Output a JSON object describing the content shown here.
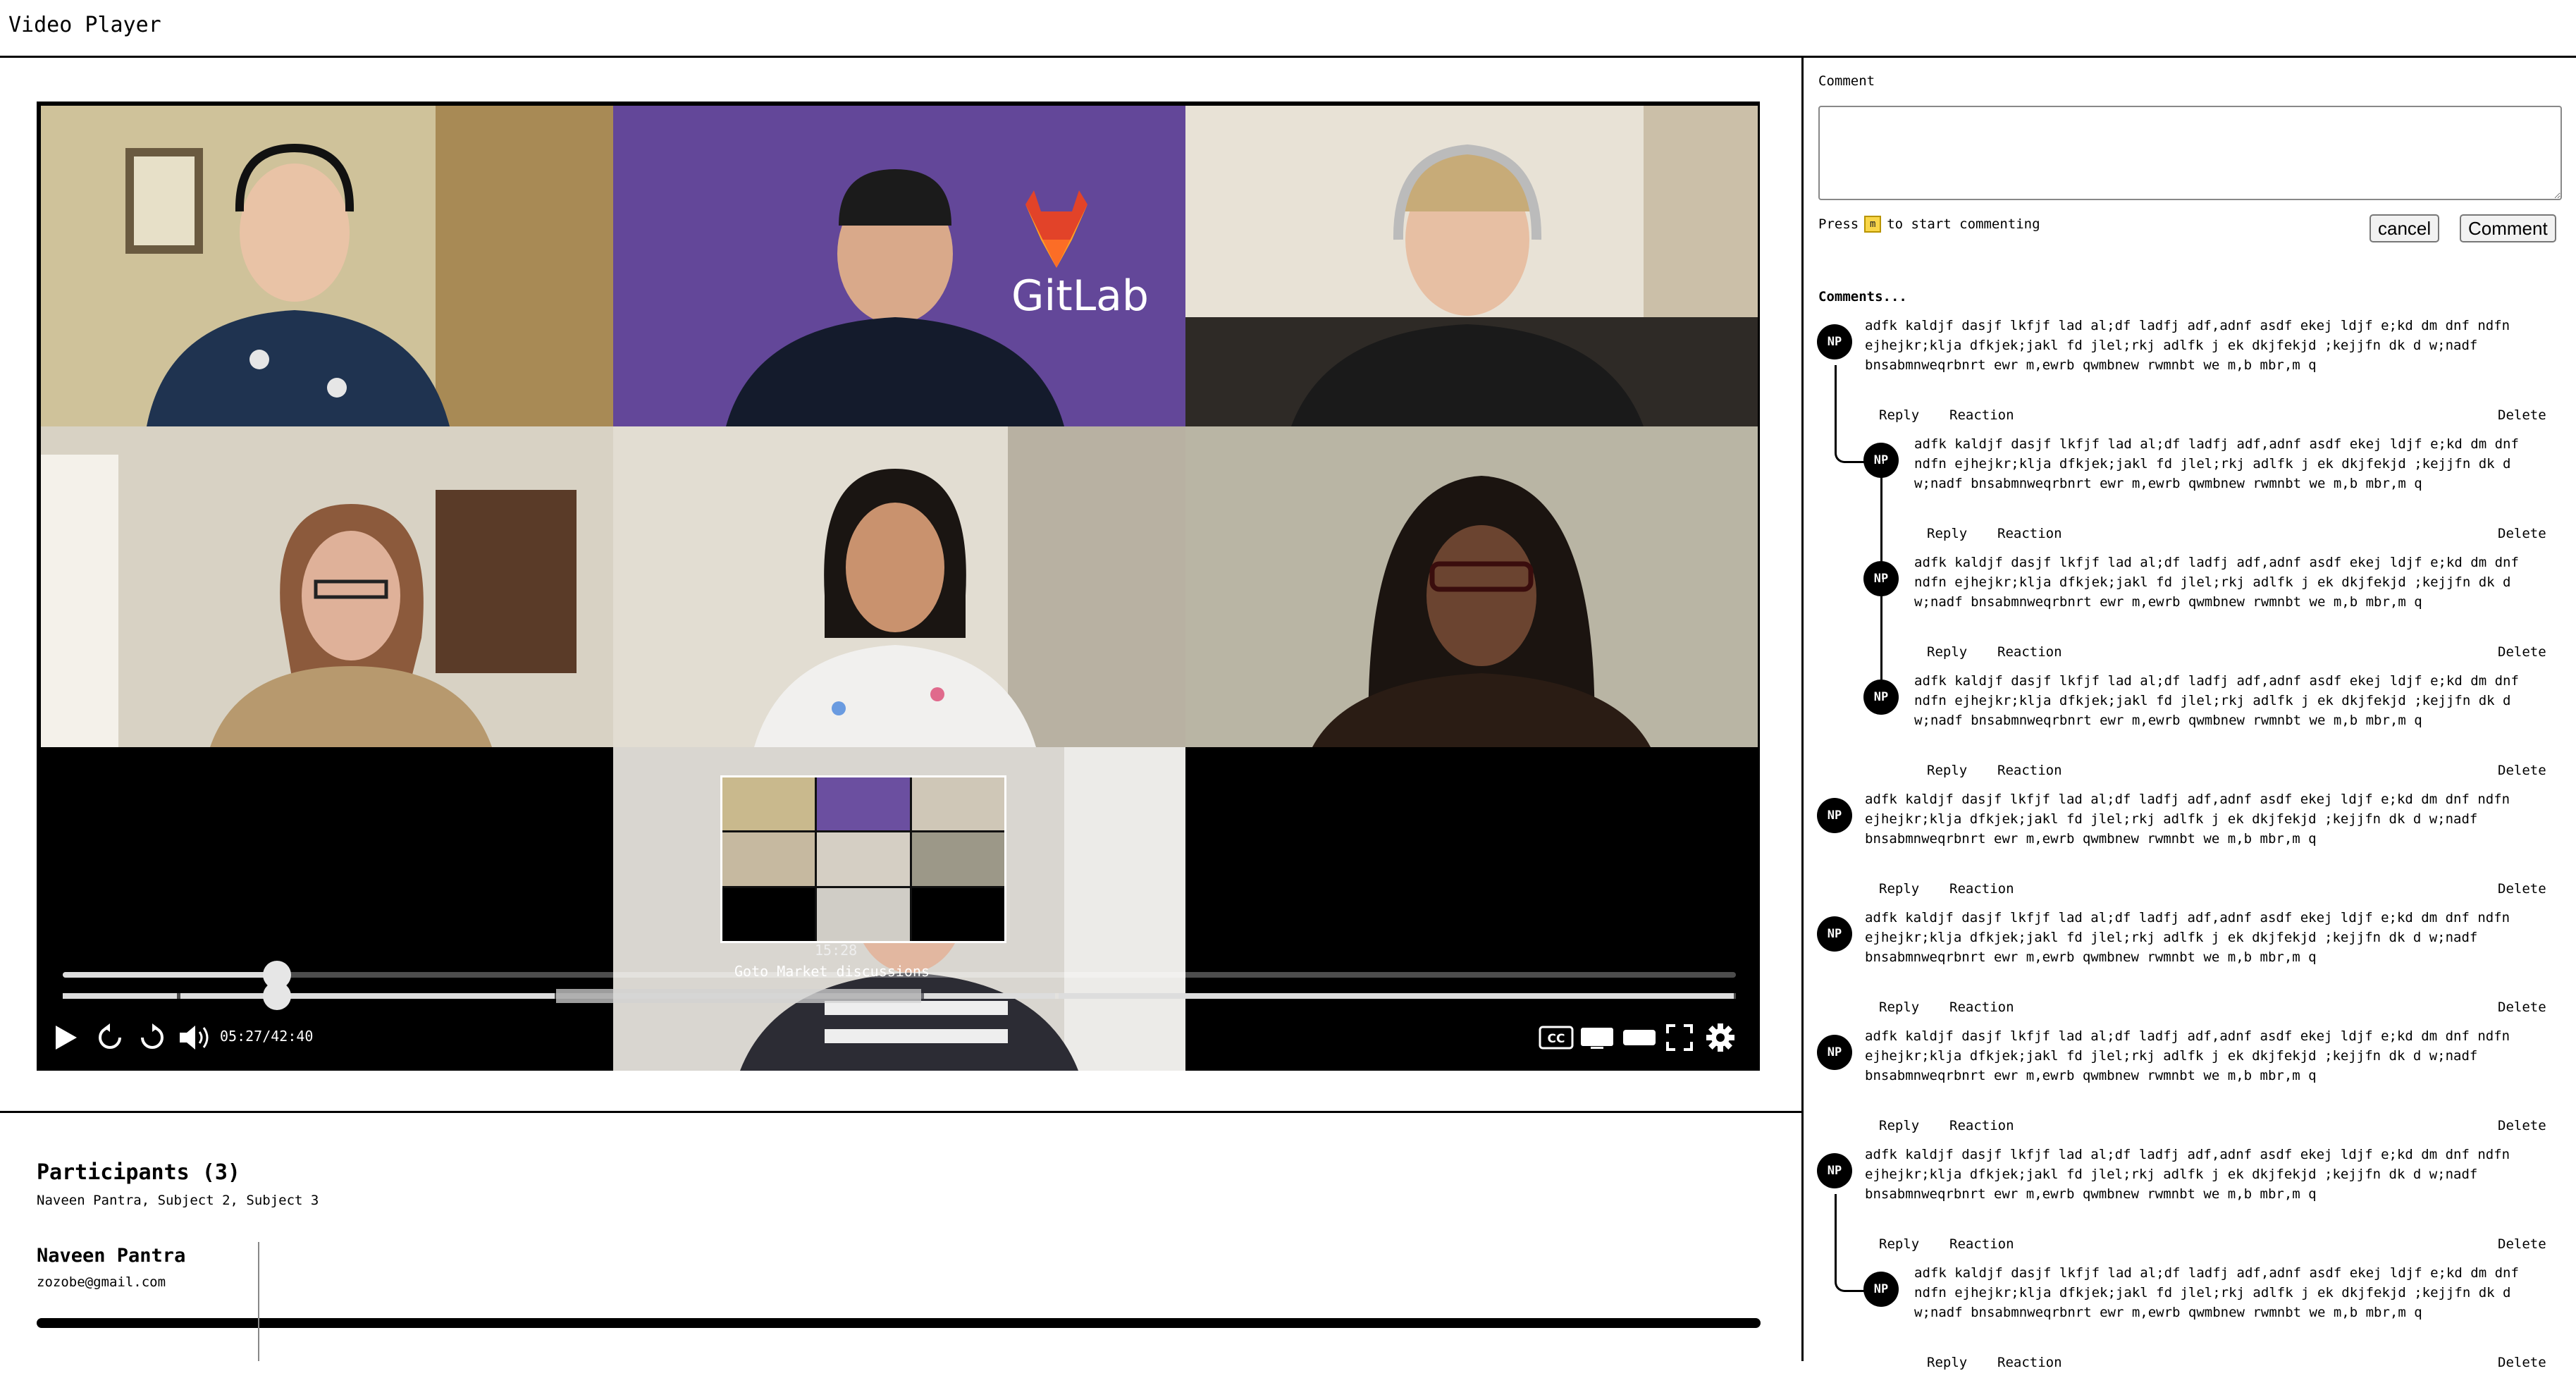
{
  "app": {
    "title": "Video Player"
  },
  "player": {
    "current_time": "05:27",
    "duration": "42:40",
    "time_display": "05:27/42:40",
    "progress_fraction": 0.128,
    "hover_preview": {
      "time": "15:28",
      "chapter": "Goto Market discussions"
    },
    "logo_text": "GitLab",
    "controls": {
      "play": "play-icon",
      "rewind": "rewind-10-icon",
      "forward": "forward-10-icon",
      "volume": "volume-icon",
      "captions": "CC",
      "theater": "theater-mode-icon",
      "miniplayer": "miniplayer-icon",
      "fullscreen": "fullscreen-icon",
      "settings": "gear-icon"
    }
  },
  "participants": {
    "title": "Participants (3)",
    "names": "Naveen Pantra, Subject 2, Subject 3",
    "list": [
      {
        "name": "Naveen Pantra",
        "email": "zozobe@gmail.com"
      }
    ]
  },
  "comment_form": {
    "label": "Comment",
    "value": "",
    "hint_prefix": "Press",
    "hint_key": "m",
    "hint_suffix": "to start commenting",
    "cancel_label": "cancel",
    "submit_label": "Comment"
  },
  "comments": {
    "header": "Comments...",
    "items": [
      {
        "initials": "NP",
        "level": 0,
        "lines": [
          "adfk kaldjf dasjf lkfjf lad al;df ladfj adf,adnf asdf ekej ldjf e;kd dm dnf ndfn",
          "ejhejkr;klja dfkjek;jakl fd jlel;rkj adlfk j ek dkjfekjd ;kejjfn dk d w;nadf",
          "bnsabmnweqrbnrt ewr m,ewrb qwmbnew rwmnbt we m,b mbr,m q"
        ],
        "reply": "Reply",
        "reaction": "Reaction",
        "delete": "Delete"
      },
      {
        "initials": "NP",
        "level": 1,
        "lines": [
          "adfk kaldjf dasjf lkfjf lad al;df ladfj adf,adnf asdf ekej ldjf e;kd dm dnf",
          "ndfn ejhejkr;klja dfkjek;jakl fd jlel;rkj adlfk j ek dkjfekjd ;kejjfn dk d",
          "w;nadf bnsabmnweqrbnrt ewr m,ewrb qwmbnew rwmnbt we m,b mbr,m q"
        ],
        "reply": "Reply",
        "reaction": "Reaction",
        "delete": "Delete"
      },
      {
        "initials": "NP",
        "level": 1,
        "lines": [
          "adfk kaldjf dasjf lkfjf lad al;df ladfj adf,adnf asdf ekej ldjf e;kd dm dnf",
          "ndfn ejhejkr;klja dfkjek;jakl fd jlel;rkj adlfk j ek dkjfekjd ;kejjfn dk d",
          "w;nadf bnsabmnweqrbnrt ewr m,ewrb qwmbnew rwmnbt we m,b mbr,m q"
        ],
        "reply": "Reply",
        "reaction": "Reaction",
        "delete": "Delete"
      },
      {
        "initials": "NP",
        "level": 1,
        "lines": [
          "adfk kaldjf dasjf lkfjf lad al;df ladfj adf,adnf asdf ekej ldjf e;kd dm dnf",
          "ndfn ejhejkr;klja dfkjek;jakl fd jlel;rkj adlfk j ek dkjfekjd ;kejjfn dk d",
          "w;nadf bnsabmnweqrbnrt ewr m,ewrb qwmbnew rwmnbt we m,b mbr,m q"
        ],
        "reply": "Reply",
        "reaction": "Reaction",
        "delete": "Delete"
      },
      {
        "initials": "NP",
        "level": 0,
        "lines": [
          "adfk kaldjf dasjf lkfjf lad al;df ladfj adf,adnf asdf ekej ldjf e;kd dm dnf ndfn",
          "ejhejkr;klja dfkjek;jakl fd jlel;rkj adlfk j ek dkjfekjd ;kejjfn dk d w;nadf",
          "bnsabmnweqrbnrt ewr m,ewrb qwmbnew rwmnbt we m,b mbr,m q"
        ],
        "reply": "Reply",
        "reaction": "Reaction",
        "delete": "Delete"
      },
      {
        "initials": "NP",
        "level": 0,
        "lines": [
          "adfk kaldjf dasjf lkfjf lad al;df ladfj adf,adnf asdf ekej ldjf e;kd dm dnf ndfn",
          "ejhejkr;klja dfkjek;jakl fd jlel;rkj adlfk j ek dkjfekjd ;kejjfn dk d w;nadf",
          "bnsabmnweqrbnrt ewr m,ewrb qwmbnew rwmnbt we m,b mbr,m q"
        ],
        "reply": "Reply",
        "reaction": "Reaction",
        "delete": "Delete"
      },
      {
        "initials": "NP",
        "level": 0,
        "lines": [
          "adfk kaldjf dasjf lkfjf lad al;df ladfj adf,adnf asdf ekej ldjf e;kd dm dnf ndfn",
          "ejhejkr;klja dfkjek;jakl fd jlel;rkj adlfk j ek dkjfekjd ;kejjfn dk d w;nadf",
          "bnsabmnweqrbnrt ewr m,ewrb qwmbnew rwmnbt we m,b mbr,m q"
        ],
        "reply": "Reply",
        "reaction": "Reaction",
        "delete": "Delete"
      },
      {
        "initials": "NP",
        "level": 0,
        "lines": [
          "adfk kaldjf dasjf lkfjf lad al;df ladfj adf,adnf asdf ekej ldjf e;kd dm dnf ndfn",
          "ejhejkr;klja dfkjek;jakl fd jlel;rkj adlfk j ek dkjfekjd ;kejjfn dk d w;nadf",
          "bnsabmnweqrbnrt ewr m,ewrb qwmbnew rwmnbt we m,b mbr,m q"
        ],
        "reply": "Reply",
        "reaction": "Reaction",
        "delete": "Delete"
      },
      {
        "initials": "NP",
        "level": 1,
        "lines": [
          "adfk kaldjf dasjf lkfjf lad al;df ladfj adf,adnf asdf ekej ldjf e;kd dm dnf",
          "ndfn ejhejkr;klja dfkjek;jakl fd jlel;rkj adlfk j ek dkjfekjd ;kejjfn dk d",
          "w;nadf bnsabmnweqrbnrt ewr m,ewrb qwmbnew rwmnbt we m,b mbr,m q"
        ],
        "reply": "Reply",
        "reaction": "Reaction",
        "delete": "Delete"
      }
    ]
  }
}
